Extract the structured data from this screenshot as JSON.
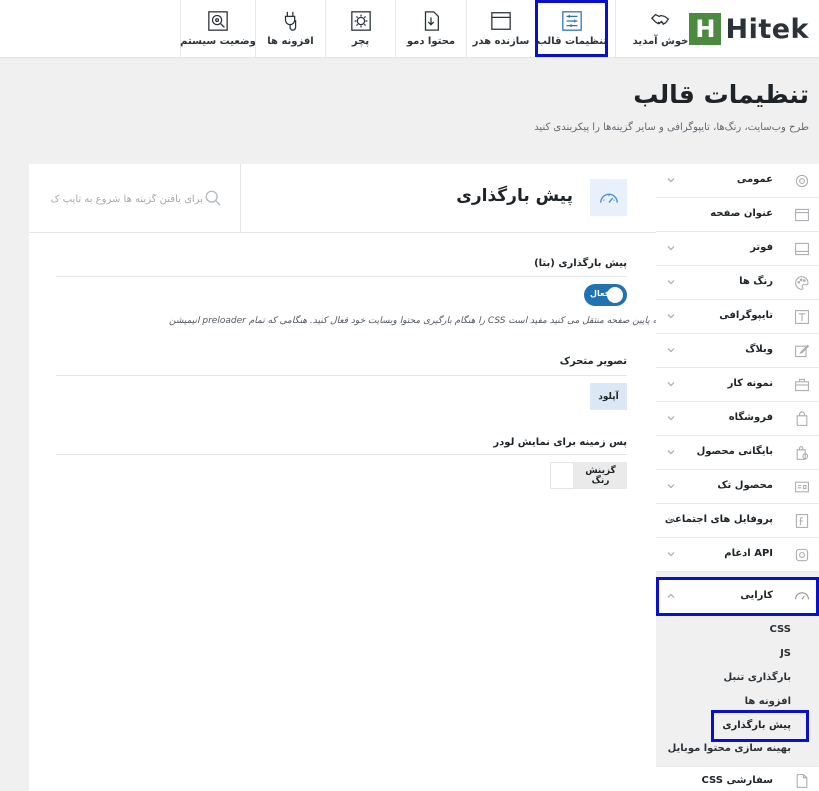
{
  "logo": {
    "letter": "H",
    "text": "Hitek"
  },
  "topnav": {
    "items": [
      {
        "label": "خوش آمدید",
        "icon": "handshake-icon"
      },
      {
        "label": "تنظیمات قالب",
        "icon": "settings-sliders-icon",
        "active": true
      },
      {
        "label": "سازنده هدر",
        "icon": "browser-window-icon"
      },
      {
        "label": "محتوا دمو",
        "icon": "download-file-icon"
      },
      {
        "label": "پچر",
        "icon": "gear-icon"
      },
      {
        "label": "افزونه ها",
        "icon": "plug-icon"
      },
      {
        "label": "وضعیت سیستم",
        "icon": "system-status-icon"
      }
    ]
  },
  "page": {
    "title": "تنظیمات قالب",
    "subtitle": "طرح وب‌سایت، رنگ‌ها، تایپوگرافی و سایر گزینه‌ها را پیکربندی کنید"
  },
  "panel": {
    "section_title": "پیش بارگذاری",
    "section_icon": "speedometer-icon",
    "search_placeholder": "برای یافتن گزینه ها شروع به تایپ ک",
    "fields": {
      "preloader_label": "پیش بارگذاری (بتا)",
      "toggle_label": "فعال",
      "toggle_on": true,
      "preloader_desc": "انیمیشن preloader را هنگام بارگیری محتوا وبسایت خود فعال کنید. هنگامی که تمام CSS را به پایین صفحه منتقل می کنید مفید است.",
      "animated_image_label": "تصویر متحرک",
      "upload_label": "آپلود",
      "bg_label": "پس زمینه برای نمایش لودر",
      "color_button_label": "گزینش رنگ"
    }
  },
  "sidebar": {
    "items": [
      {
        "label": "عمومی",
        "icon": "gear-icon",
        "chevron": true
      },
      {
        "label": "عنوان صفحه",
        "icon": "page-header-icon",
        "chevron": false
      },
      {
        "label": "فوتر",
        "icon": "footer-icon",
        "chevron": true
      },
      {
        "label": "رنگ ها",
        "icon": "palette-icon",
        "chevron": true
      },
      {
        "label": "تایپوگرافی",
        "icon": "typography-icon",
        "chevron": true
      },
      {
        "label": "وبلاگ",
        "icon": "edit-icon",
        "chevron": true
      },
      {
        "label": "نمونه کار",
        "icon": "briefcase-icon",
        "chevron": true
      },
      {
        "label": "فروشگاه",
        "icon": "shopping-bag-icon",
        "chevron": true
      },
      {
        "label": "بایگانی محصول",
        "icon": "product-archive-icon",
        "chevron": true
      },
      {
        "label": "محصول تک",
        "icon": "product-card-icon",
        "chevron": true
      },
      {
        "label": "پروفایل های اجتماعی",
        "icon": "social-icon",
        "chevron": true
      },
      {
        "label": "ادغام API",
        "icon": "api-icon",
        "chevron": true
      },
      {
        "label": "کارایی",
        "icon": "speedometer-icon",
        "chevron": true,
        "active": true
      }
    ],
    "subitems": [
      {
        "label": "CSS"
      },
      {
        "label": "JS"
      },
      {
        "label": "بارگذاری تنبل"
      },
      {
        "label": "افزونه ها"
      },
      {
        "label": "پیش بارگذاری",
        "current": true
      },
      {
        "label": "بهینه سازی محتوا موبایل"
      }
    ],
    "bottom": {
      "label": "CSS سفارشی",
      "icon": "css-file-icon"
    }
  },
  "colors": {
    "accent": "#2271b1",
    "highlight_outline": "#0a10c9",
    "logo_green": "#4d8a41",
    "background": "#f0f0f1"
  }
}
